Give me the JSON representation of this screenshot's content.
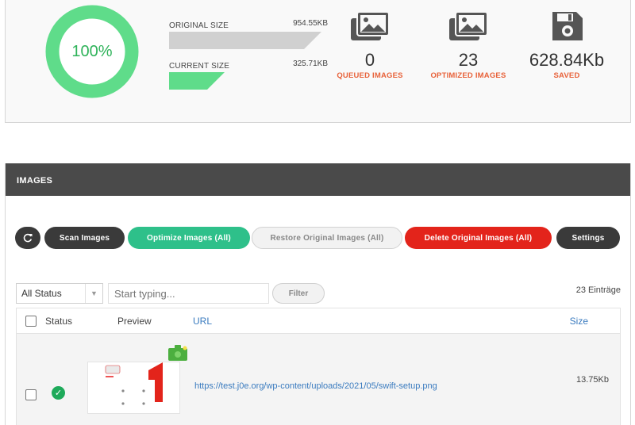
{
  "stats": {
    "percent": "100%",
    "original_size_label": "ORIGINAL SIZE",
    "original_size_value": "954.55KB",
    "current_size_label": "CURRENT SIZE",
    "current_size_value": "325.71KB",
    "queued_count": "0",
    "queued_label": "QUEUED IMAGES",
    "optimized_count": "23",
    "optimized_label": "OPTIMIZED IMAGES",
    "saved_amount": "628.84Kb",
    "saved_label": "SAVED",
    "icons": [
      "images-icon",
      "images-icon",
      "floppy-disk-icon"
    ],
    "colors": {
      "ring": "#5fdc8a",
      "accent_caption": "#e8623a",
      "current_bar": "#5fdc8a",
      "original_bar": "#cfcfcf"
    }
  },
  "images": {
    "header": "IMAGES",
    "buttons": {
      "refresh_icon": "refresh-icon",
      "scan": "Scan Images",
      "optimize": "Optimize Images (All)",
      "restore": "Restore Original Images (All)",
      "delete": "Delete Original Images (All)",
      "settings": "Settings"
    },
    "status_filter": "All Status",
    "search_placeholder": "Start typing...",
    "filter_button": "Filter",
    "entries": "23 Einträge",
    "columns": {
      "status": "Status",
      "preview": "Preview",
      "url": "URL",
      "size": "Size"
    },
    "rows": [
      {
        "status": "optimized",
        "url": "https://test.j0e.org/wp-content/uploads/2021/05/swift-setup.png",
        "size": "13.75Kb"
      }
    ]
  }
}
